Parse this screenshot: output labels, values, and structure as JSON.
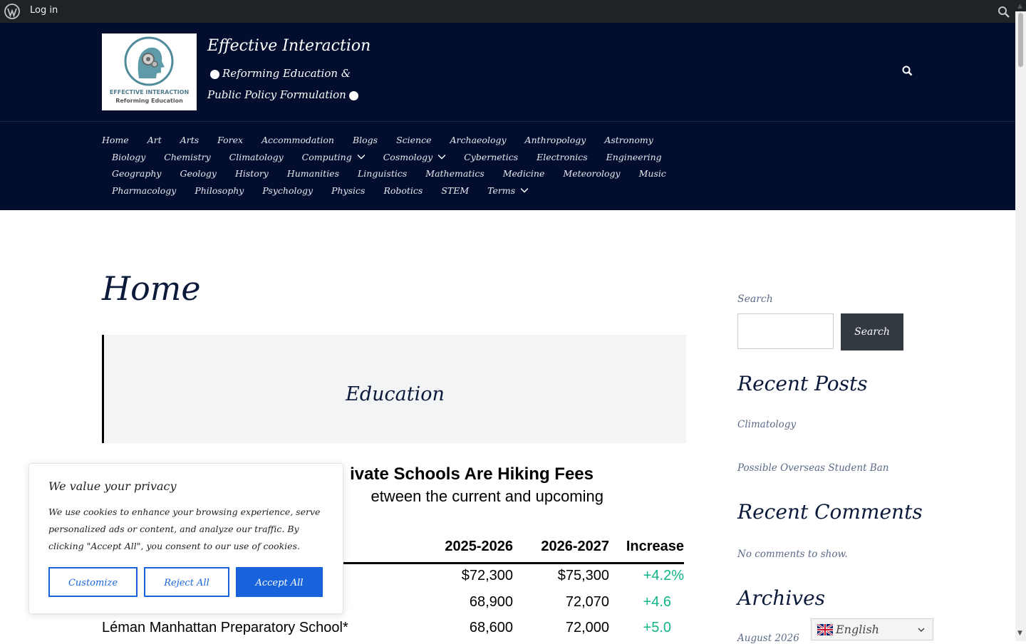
{
  "admin_bar": {
    "login_label": "Log in"
  },
  "site": {
    "title": "Effective Interaction",
    "tagline_line1": "Reforming Education &",
    "tagline_line2": "Public Policy Formulation",
    "logo_caption1": "EFFECTIVE INTERACTION",
    "logo_caption2": "Reforming Education"
  },
  "nav": {
    "rows": [
      [
        "Home",
        "Art",
        "Arts",
        "Forex",
        "Accommodation",
        "Blogs",
        "Science",
        "Archaeology",
        "Anthropology",
        "Astronomy"
      ],
      [
        "Biology",
        "Chemistry",
        "Climatology",
        "Computing",
        "Cosmology",
        "Cybernetics",
        "Electronics",
        "Engineering"
      ],
      [
        "Geography",
        "Geology",
        "History",
        "Humanities",
        "Linguistics",
        "Mathematics",
        "Medicine",
        "Meteorology",
        "Music"
      ],
      [
        "Pharmacology",
        "Philosophy",
        "Psychology",
        "Physics",
        "Robotics",
        "STEM",
        "Terms"
      ]
    ],
    "dropdown_items": [
      "Computing",
      "Cosmology",
      "Terms"
    ]
  },
  "main": {
    "page_title": "Home",
    "quote_text": "Education",
    "article_image": {
      "headline_fragment": "ivate Schools Are Hiking Fees",
      "subhead_fragment": "etween the current and upcoming",
      "columns": [
        "2025-2026",
        "2026-2027",
        "Increase"
      ],
      "rows": [
        {
          "school": "",
          "y1": "$72,300",
          "y2": "$75,300",
          "inc": "+4.2%"
        },
        {
          "school": "",
          "y1": "68,900",
          "y2": "72,070",
          "inc": "+4.6"
        },
        {
          "school": "Léman Manhattan Preparatory School*",
          "y1": "68,600",
          "y2": "72,000",
          "inc": "+5.0"
        }
      ]
    }
  },
  "sidebar": {
    "search_label": "Search",
    "search_button": "Search",
    "recent_posts_heading": "Recent Posts",
    "recent_posts": [
      "Climatology",
      "Possible Overseas Student Ban"
    ],
    "recent_comments_heading": "Recent Comments",
    "no_comments": "No comments to show.",
    "archives_heading": "Archives",
    "archive_first": "August 2026"
  },
  "cookie": {
    "title": "We value your privacy",
    "body": "We use cookies to enhance your browsing experience, serve personalized ads or content, and analyze our traffic. By clicking \"Accept All\", you consent to our use of cookies.",
    "customize": "Customize",
    "reject": "Reject All",
    "accept": "Accept All",
    "accent_color": "#1863dc"
  },
  "language": {
    "label": "English"
  },
  "colors": {
    "header_bg": "#030e2e",
    "admin_bg": "#1d2327",
    "increase_green": "#0fb487"
  }
}
